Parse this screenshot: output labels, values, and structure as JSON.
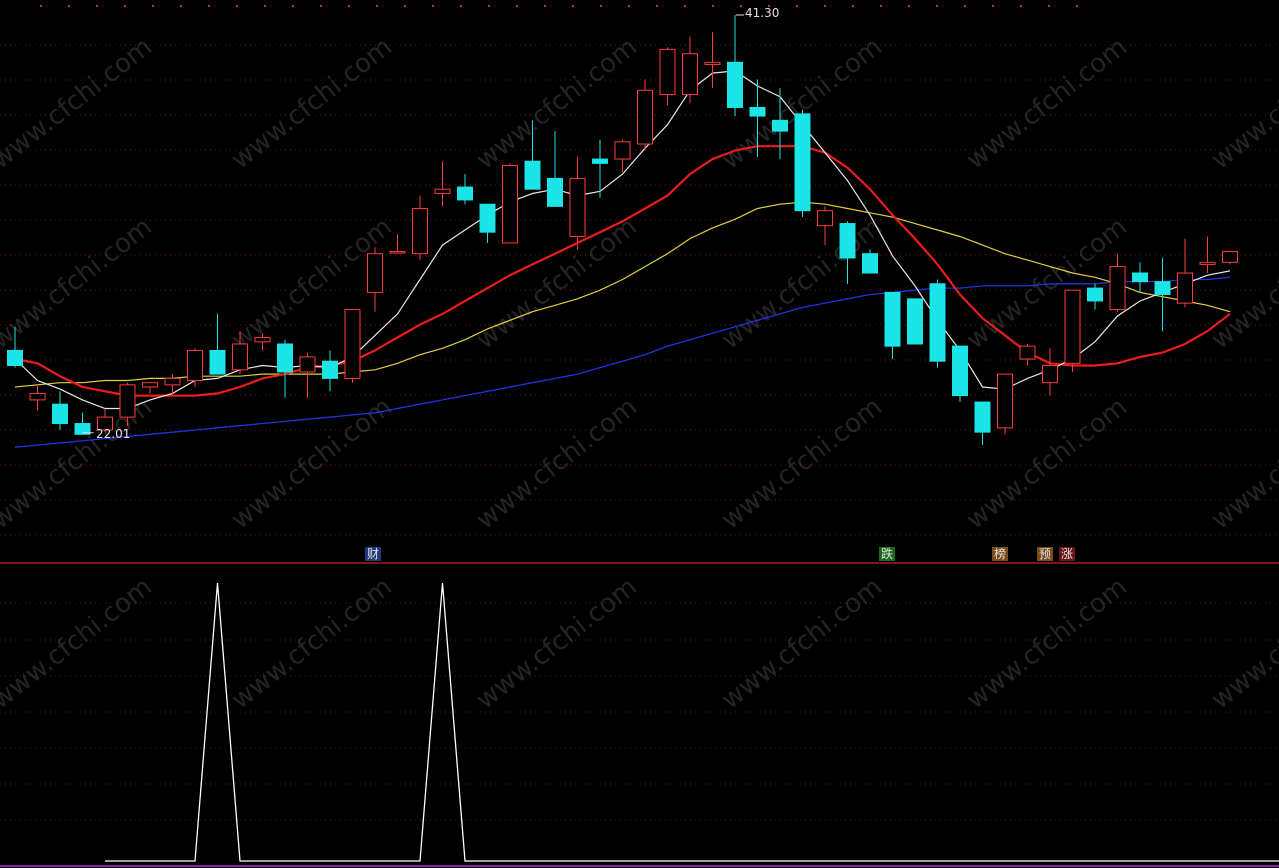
{
  "chart_data": [
    {
      "type": "candlestick",
      "x": [
        1,
        2,
        3,
        4,
        5,
        6,
        7,
        8,
        9,
        10,
        11,
        12,
        13,
        14,
        15,
        16,
        17,
        18,
        19,
        20,
        21,
        22,
        23,
        24,
        25,
        26,
        27,
        28,
        29,
        30,
        31,
        32,
        33,
        34,
        35,
        36,
        37,
        38,
        39,
        40,
        41,
        42,
        43,
        44,
        45,
        46,
        47,
        48,
        49,
        50,
        51,
        52,
        53,
        54,
        55
      ],
      "candles": [
        {
          "o": 25.7,
          "h": 26.8,
          "l": 24.9,
          "c": 25.0
        },
        {
          "o": 23.4,
          "h": 24.1,
          "l": 22.9,
          "c": 23.7
        },
        {
          "o": 23.2,
          "h": 23.8,
          "l": 22.0,
          "c": 22.3
        },
        {
          "o": 22.3,
          "h": 22.8,
          "l": 21.8,
          "c": 21.8
        },
        {
          "o": 22.0,
          "h": 23.0,
          "l": 21.9,
          "c": 22.6
        },
        {
          "o": 22.6,
          "h": 24.2,
          "l": 22.2,
          "c": 24.1
        },
        {
          "o": 24.0,
          "h": 24.2,
          "l": 23.7,
          "c": 24.2
        },
        {
          "o": 24.1,
          "h": 24.6,
          "l": 23.6,
          "c": 24.4
        },
        {
          "o": 24.3,
          "h": 25.8,
          "l": 24.0,
          "c": 25.7
        },
        {
          "o": 25.7,
          "h": 27.4,
          "l": 25.0,
          "c": 24.6
        },
        {
          "o": 24.8,
          "h": 26.6,
          "l": 24.6,
          "c": 26.0
        },
        {
          "o": 26.1,
          "h": 26.5,
          "l": 25.7,
          "c": 26.3
        },
        {
          "o": 26.0,
          "h": 26.2,
          "l": 23.5,
          "c": 24.7
        },
        {
          "o": 24.7,
          "h": 25.6,
          "l": 23.5,
          "c": 25.4
        },
        {
          "o": 25.2,
          "h": 25.7,
          "l": 23.8,
          "c": 24.4
        },
        {
          "o": 24.4,
          "h": 27.6,
          "l": 24.2,
          "c": 27.6
        },
        {
          "o": 28.4,
          "h": 30.5,
          "l": 27.5,
          "c": 30.2
        },
        {
          "o": 30.3,
          "h": 31.1,
          "l": 30.2,
          "c": 30.3
        },
        {
          "o": 30.2,
          "h": 32.9,
          "l": 29.9,
          "c": 32.3
        },
        {
          "o": 33.0,
          "h": 34.5,
          "l": 32.4,
          "c": 33.2
        },
        {
          "o": 33.3,
          "h": 33.9,
          "l": 32.5,
          "c": 32.7
        },
        {
          "o": 32.5,
          "h": 32.5,
          "l": 30.7,
          "c": 31.2
        },
        {
          "o": 30.7,
          "h": 34.4,
          "l": 30.7,
          "c": 34.3
        },
        {
          "o": 34.5,
          "h": 36.4,
          "l": 33.5,
          "c": 33.2
        },
        {
          "o": 33.7,
          "h": 35.9,
          "l": 32.7,
          "c": 32.4
        },
        {
          "o": 31.0,
          "h": 34.7,
          "l": 30.4,
          "c": 33.7
        },
        {
          "o": 34.6,
          "h": 35.5,
          "l": 32.8,
          "c": 34.4
        },
        {
          "o": 34.6,
          "h": 35.5,
          "l": 34.0,
          "c": 35.4
        },
        {
          "o": 35.3,
          "h": 38.3,
          "l": 35.0,
          "c": 37.8
        },
        {
          "o": 37.6,
          "h": 39.8,
          "l": 37.1,
          "c": 39.7
        },
        {
          "o": 37.6,
          "h": 40.3,
          "l": 37.2,
          "c": 39.5
        },
        {
          "o": 39.0,
          "h": 40.5,
          "l": 37.9,
          "c": 39.1
        },
        {
          "o": 39.1,
          "h": 41.3,
          "l": 36.6,
          "c": 37.0
        },
        {
          "o": 37.0,
          "h": 38.3,
          "l": 34.7,
          "c": 36.6
        },
        {
          "o": 36.4,
          "h": 37.9,
          "l": 34.6,
          "c": 35.9
        },
        {
          "o": 36.7,
          "h": 36.9,
          "l": 31.9,
          "c": 32.2
        },
        {
          "o": 31.5,
          "h": 32.4,
          "l": 30.6,
          "c": 32.2
        },
        {
          "o": 31.6,
          "h": 31.7,
          "l": 28.8,
          "c": 30.0
        },
        {
          "o": 30.2,
          "h": 30.4,
          "l": 29.3,
          "c": 29.3
        },
        {
          "o": 28.4,
          "h": 28.4,
          "l": 25.3,
          "c": 25.9
        },
        {
          "o": 28.1,
          "h": 28.1,
          "l": 26.0,
          "c": 26.0
        },
        {
          "o": 28.8,
          "h": 29.0,
          "l": 24.9,
          "c": 25.2
        },
        {
          "o": 25.9,
          "h": 25.9,
          "l": 23.3,
          "c": 23.6
        },
        {
          "o": 23.3,
          "h": 23.3,
          "l": 21.3,
          "c": 21.9
        },
        {
          "o": 22.1,
          "h": 24.6,
          "l": 21.8,
          "c": 24.6
        },
        {
          "o": 25.3,
          "h": 26.0,
          "l": 25.0,
          "c": 25.9
        },
        {
          "o": 24.2,
          "h": 25.8,
          "l": 23.6,
          "c": 25.0
        },
        {
          "o": 25.1,
          "h": 26.5,
          "l": 24.7,
          "c": 28.5
        },
        {
          "o": 28.6,
          "h": 28.8,
          "l": 27.6,
          "c": 28.0
        },
        {
          "o": 27.6,
          "h": 30.2,
          "l": 27.5,
          "c": 29.6
        },
        {
          "o": 29.3,
          "h": 29.8,
          "l": 28.4,
          "c": 28.9
        },
        {
          "o": 28.9,
          "h": 30.0,
          "l": 26.6,
          "c": 28.3
        },
        {
          "o": 27.9,
          "h": 30.9,
          "l": 27.7,
          "c": 29.3
        },
        {
          "o": 29.7,
          "h": 31.0,
          "l": 29.3,
          "c": 29.8
        },
        {
          "o": 29.8,
          "h": 30.3,
          "l": 29.7,
          "c": 30.3
        }
      ],
      "ma_white": [
        25.3,
        24.3,
        23.9,
        23.4,
        23.0,
        23.0,
        23.4,
        23.7,
        24.3,
        24.4,
        24.8,
        25.0,
        24.9,
        25.0,
        24.9,
        25.4,
        26.4,
        27.4,
        29.0,
        30.6,
        31.3,
        32.0,
        32.6,
        33.0,
        33.2,
        32.9,
        33.1,
        33.9,
        35.1,
        36.2,
        37.8,
        38.6,
        38.7,
        38.0,
        37.5,
        36.2,
        34.9,
        33.6,
        32.0,
        30.1,
        28.7,
        27.1,
        25.7,
        24.0,
        23.9,
        24.4,
        24.8,
        25.3,
        26.1,
        27.3,
        28.0,
        28.4,
        28.8,
        29.2,
        29.4
      ],
      "ma_red": [
        25.3,
        25.1,
        24.5,
        24.0,
        23.8,
        23.6,
        23.6,
        23.6,
        23.6,
        23.7,
        24.0,
        24.4,
        24.6,
        24.9,
        25.0,
        25.2,
        25.7,
        26.3,
        26.9,
        27.4,
        28.0,
        28.6,
        29.2,
        29.7,
        30.2,
        30.7,
        31.2,
        31.7,
        32.3,
        32.9,
        33.9,
        34.6,
        35.0,
        35.2,
        35.2,
        35.2,
        34.9,
        34.2,
        33.2,
        32.0,
        30.9,
        29.7,
        28.3,
        27.2,
        26.4,
        25.6,
        25.1,
        25.0,
        25.0,
        25.1,
        25.4,
        25.6,
        26.0,
        26.6,
        27.4
      ],
      "ma_yellow": [
        24.0,
        24.1,
        24.2,
        24.2,
        24.3,
        24.3,
        24.4,
        24.4,
        24.5,
        24.5,
        24.5,
        24.6,
        24.6,
        24.6,
        24.6,
        24.7,
        24.8,
        25.1,
        25.5,
        25.8,
        26.2,
        26.7,
        27.1,
        27.5,
        27.8,
        28.1,
        28.5,
        29.0,
        29.6,
        30.2,
        30.9,
        31.4,
        31.8,
        32.3,
        32.5,
        32.6,
        32.5,
        32.3,
        32.1,
        31.9,
        31.6,
        31.3,
        31.0,
        30.6,
        30.2,
        29.9,
        29.6,
        29.3,
        29.1,
        28.8,
        28.4,
        28.2,
        28.0,
        27.8,
        27.5
      ],
      "ma_blue": [
        21.2,
        21.3,
        21.4,
        21.5,
        21.6,
        21.7,
        21.8,
        21.9,
        22.0,
        22.1,
        22.2,
        22.3,
        22.4,
        22.5,
        22.6,
        22.7,
        22.8,
        23.0,
        23.2,
        23.4,
        23.6,
        23.8,
        24.0,
        24.2,
        24.4,
        24.6,
        24.9,
        25.2,
        25.5,
        25.9,
        26.2,
        26.5,
        26.8,
        27.1,
        27.4,
        27.7,
        27.9,
        28.1,
        28.3,
        28.4,
        28.5,
        28.6,
        28.6,
        28.7,
        28.7,
        28.7,
        28.8,
        28.8,
        28.8,
        28.9,
        28.9,
        28.9,
        29.0,
        29.0,
        29.1
      ],
      "annotations": [
        {
          "label": "41.30",
          "x": 33
        },
        {
          "label": "22.01",
          "x": 4
        }
      ],
      "grid": true
    },
    {
      "type": "line",
      "x": [
        1,
        2,
        3,
        4,
        5,
        6,
        7,
        8,
        9,
        10,
        11,
        12,
        13,
        14,
        15,
        16,
        17,
        18,
        19,
        20,
        21,
        22,
        23,
        24,
        25,
        26,
        27,
        28,
        29,
        30,
        31,
        32,
        33,
        34,
        35,
        36,
        37,
        38,
        39,
        40,
        41,
        42,
        43,
        44,
        45,
        46,
        47,
        48,
        49,
        50,
        51,
        52,
        53,
        54,
        55
      ],
      "values": [
        0,
        0,
        0,
        0,
        0,
        1,
        0,
        0,
        0,
        0,
        0,
        0,
        0,
        0,
        0,
        1,
        0,
        0,
        0,
        0,
        0,
        0,
        0,
        0,
        0,
        0,
        0,
        0,
        0,
        0,
        0,
        0,
        0,
        0,
        0,
        0,
        0,
        0,
        0,
        0,
        0,
        0,
        0,
        0,
        0,
        0,
        0,
        0,
        0,
        0,
        0,
        0,
        0,
        0,
        0
      ],
      "grid": true
    }
  ],
  "signals": [
    {
      "label": "财",
      "x": 17
    },
    {
      "label": "跌",
      "x": 40
    },
    {
      "label": "榜",
      "x": 45
    },
    {
      "label": "预",
      "x": 47
    },
    {
      "label": "涨",
      "x": 48
    }
  ],
  "watermark": "www.cfchi.com",
  "colors": {
    "up": "#ff3b3b",
    "down": "#1ce5e8",
    "ma_white": "#e8e8e8",
    "ma_red": "#ee1c1c",
    "ma_yellow": "#e0d040",
    "ma_blue": "#2233dd",
    "grid": "#7a1010",
    "divider": "#aa1a2a"
  }
}
